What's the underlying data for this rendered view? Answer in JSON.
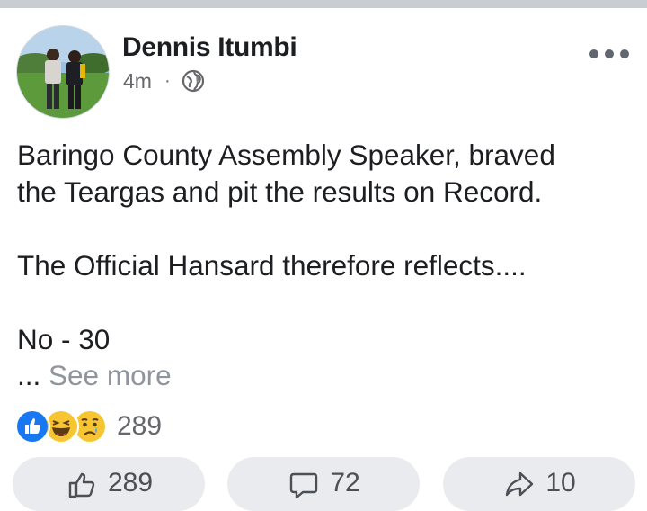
{
  "post": {
    "author": "Dennis Itumbi",
    "time": "4m",
    "separator": "·",
    "privacy_icon": "globe-icon",
    "more_icon": "ellipsis-icon",
    "lines": [
      "Baringo County Assembly Speaker, braved\nthe Teargas and pit the results on Record.",
      "The Official Hansard therefore reflects....",
      "No - 30"
    ],
    "ellipsis": "...",
    "see_more": "See more"
  },
  "reactions": {
    "icons": [
      "like-reaction-icon",
      "haha-reaction-icon",
      "sad-reaction-icon"
    ],
    "count": "289"
  },
  "actions": {
    "like_count": "289",
    "comment_count": "72",
    "share_count": "10"
  },
  "colors": {
    "like_blue": "#1877f2",
    "emoji_yellow": "#f7c531",
    "text_gray": "#65676b",
    "button_bg": "#e9ebee"
  }
}
